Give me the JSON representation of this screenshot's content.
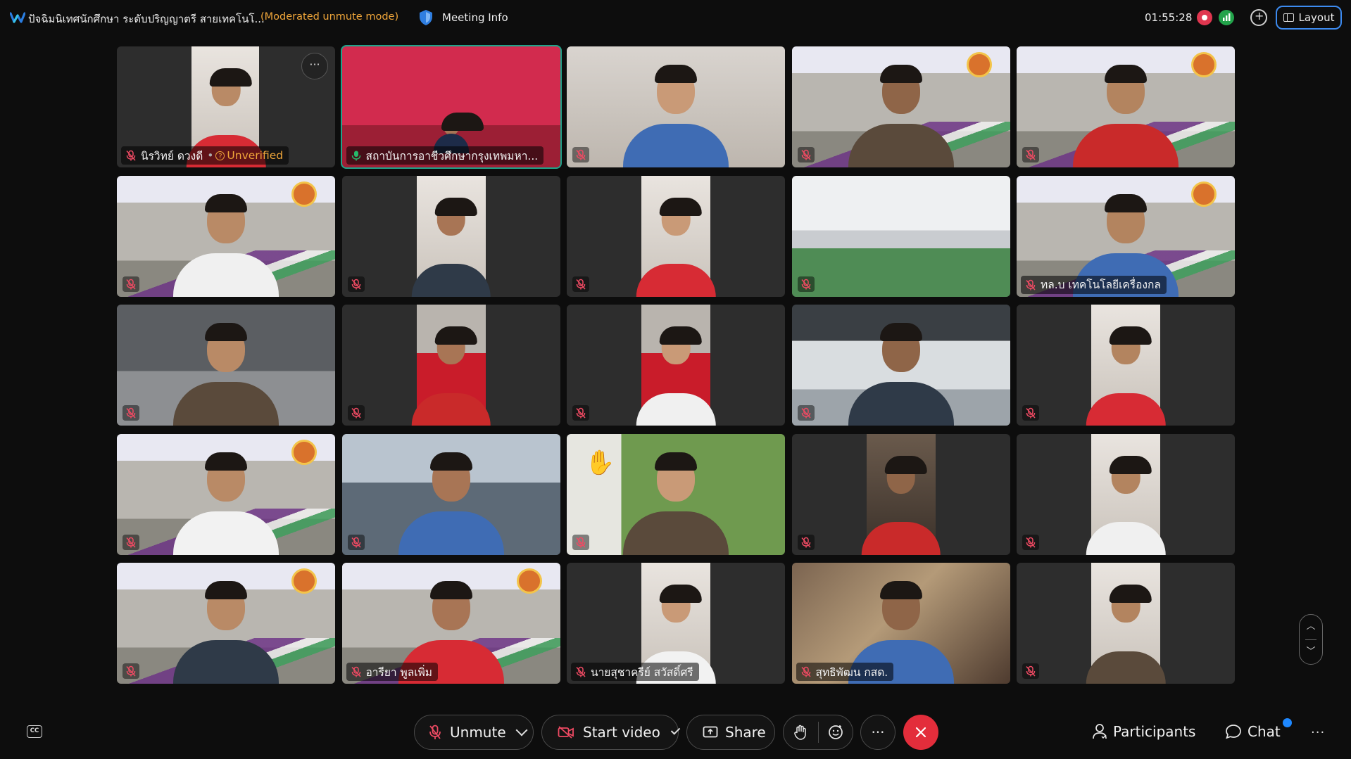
{
  "topbar": {
    "meeting_title": "ปัจฉิมนิเทศนักศึกษา ระดับปริญญาตรี สายเทคโนโ...",
    "mode_label": "(Moderated unmute mode)",
    "meeting_info_label": "Meeting Info",
    "clock": "01:55:28",
    "layout_label": "Layout"
  },
  "participants": [
    {
      "name": "นิรวิทย์ ดวงดี",
      "status": "Unverified",
      "bg": "blank",
      "muted": true
    },
    {
      "name": "สถาบันการอาชีวศึกษากรุงเทพมหา...",
      "bg": "red",
      "muted": false,
      "active": true
    },
    {
      "name": "",
      "bg": "wall",
      "muted": true
    },
    {
      "name": "",
      "bg": "poster",
      "muted": true
    },
    {
      "name": "",
      "bg": "poster",
      "muted": true
    },
    {
      "name": "",
      "bg": "poster",
      "muted": true
    },
    {
      "name": "",
      "bg": "strip",
      "muted": true
    },
    {
      "name": "",
      "bg": "strip",
      "muted": true
    },
    {
      "name": "",
      "bg": "room",
      "muted": true
    },
    {
      "name": "ทล.บ เทคโนโลยีเครื่องกล",
      "bg": "poster",
      "muted": true
    },
    {
      "name": "",
      "bg": "warehouse",
      "muted": true
    },
    {
      "name": "",
      "bg": "strip-red",
      "muted": true
    },
    {
      "name": "",
      "bg": "strip-red",
      "muted": true
    },
    {
      "name": "",
      "bg": "hall",
      "muted": true
    },
    {
      "name": "",
      "bg": "strip",
      "muted": true
    },
    {
      "name": "",
      "bg": "poster",
      "muted": true
    },
    {
      "name": "",
      "bg": "office",
      "muted": true
    },
    {
      "name": "",
      "bg": "park",
      "muted": true,
      "hand_raised": true
    },
    {
      "name": "",
      "bg": "strip-dark",
      "muted": true
    },
    {
      "name": "",
      "bg": "strip",
      "muted": true
    },
    {
      "name": "",
      "bg": "poster",
      "muted": true
    },
    {
      "name": "อารียา พูลเพิ่ม",
      "bg": "poster",
      "muted": true
    },
    {
      "name": "นายสุชาครีย์ สวัสดิ์ศรี",
      "bg": "strip",
      "muted": true
    },
    {
      "name": "สุทธิพัฒน กสด.",
      "bg": "blur",
      "muted": true
    },
    {
      "name": "",
      "bg": "strip",
      "muted": true
    }
  ],
  "controls": {
    "unmute_label": "Unmute",
    "start_video_label": "Start video",
    "share_label": "Share",
    "participants_label": "Participants",
    "chat_label": "Chat",
    "cc_label": "CC"
  },
  "colors": {
    "accent_blue": "#3d8bf0",
    "active_speaker": "#1ea48a",
    "end_red": "#e32d3b",
    "warning_orange": "#f0a63a",
    "mic_off_red": "#e0364f"
  }
}
